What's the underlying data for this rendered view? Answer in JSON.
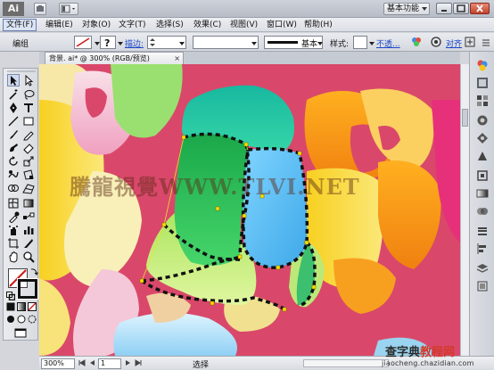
{
  "app": {
    "logo": "Ai",
    "workspace": "基本功能"
  },
  "menu": [
    "文件(F)",
    "编辑(E)",
    "对象(O)",
    "文字(T)",
    "选择(S)",
    "效果(C)",
    "视图(V)",
    "窗口(W)",
    "帮助(H)"
  ],
  "control_bar": {
    "selection": "编组",
    "stroke_label": "描边:",
    "brush_name": "基本",
    "style_label": "样式:",
    "opacity_link": "不透...",
    "align_link": "对齐"
  },
  "document": {
    "tab_title": "背景. ai* @ 300% (RGB/预览)",
    "tab_close": "×"
  },
  "status": {
    "zoom": "300%",
    "page": "1",
    "tool_text": "选择"
  },
  "watermark": "騰龍視覺WWW.TLVI.NET",
  "site": {
    "name_part1": "查字典",
    "name_part2": "教程网",
    "url": "jiaocheng.chazidian.com"
  },
  "colors": {
    "background": "#d9486a",
    "teal": "#1fc6a8",
    "green": "#28c25a",
    "blue": "#5cc0f0",
    "yellow": "#f5c518",
    "orange": "#f59a1a",
    "anchor": "#ffd700"
  }
}
